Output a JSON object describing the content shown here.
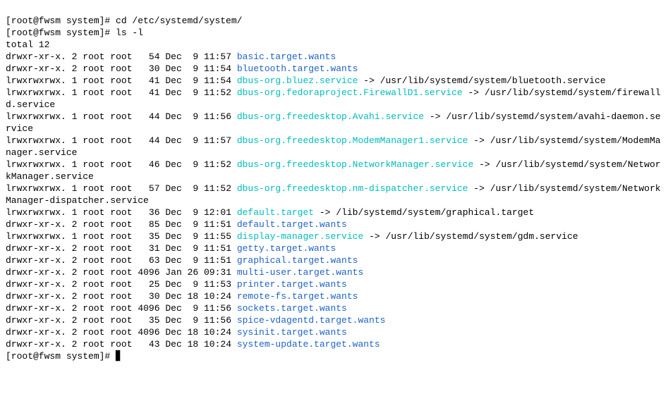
{
  "prompt_user": "root",
  "prompt_host": "fwsm",
  "prompt_cwd": "system",
  "prompt_char": "#",
  "commands": [
    "cd /etc/systemd/system/",
    "ls -l"
  ],
  "total_line": "total 12",
  "cursor_glyph": "▋",
  "entries": [
    {
      "perm": "drwxr-xr-x.",
      "links": "2",
      "owner": "root",
      "group": "root",
      "size": "54",
      "month": "Dec",
      "day": "9",
      "time": "11:57",
      "name": "basic.target.wants",
      "type": "dir"
    },
    {
      "perm": "drwxr-xr-x.",
      "links": "2",
      "owner": "root",
      "group": "root",
      "size": "30",
      "month": "Dec",
      "day": "9",
      "time": "11:54",
      "name": "bluetooth.target.wants",
      "type": "dir"
    },
    {
      "perm": "lrwxrwxrwx.",
      "links": "1",
      "owner": "root",
      "group": "root",
      "size": "41",
      "month": "Dec",
      "day": "9",
      "time": "11:54",
      "name": "dbus-org.bluez.service",
      "type": "link",
      "target": "/usr/lib/systemd/system/bluetooth.service"
    },
    {
      "perm": "lrwxrwxrwx.",
      "links": "1",
      "owner": "root",
      "group": "root",
      "size": "41",
      "month": "Dec",
      "day": "9",
      "time": "11:52",
      "name": "dbus-org.fedoraproject.FirewallD1.service",
      "type": "link",
      "target": "/usr/lib/systemd/system/firewalld.service"
    },
    {
      "perm": "lrwxrwxrwx.",
      "links": "1",
      "owner": "root",
      "group": "root",
      "size": "44",
      "month": "Dec",
      "day": "9",
      "time": "11:56",
      "name": "dbus-org.freedesktop.Avahi.service",
      "type": "link",
      "target": "/usr/lib/systemd/system/avahi-daemon.service"
    },
    {
      "perm": "lrwxrwxrwx.",
      "links": "1",
      "owner": "root",
      "group": "root",
      "size": "44",
      "month": "Dec",
      "day": "9",
      "time": "11:57",
      "name": "dbus-org.freedesktop.ModemManager1.service",
      "type": "link",
      "target": "/usr/lib/systemd/system/ModemManager.service"
    },
    {
      "perm": "lrwxrwxrwx.",
      "links": "1",
      "owner": "root",
      "group": "root",
      "size": "46",
      "month": "Dec",
      "day": "9",
      "time": "11:52",
      "name": "dbus-org.freedesktop.NetworkManager.service",
      "type": "link",
      "target": "/usr/lib/systemd/system/NetworkManager.service"
    },
    {
      "perm": "lrwxrwxrwx.",
      "links": "1",
      "owner": "root",
      "group": "root",
      "size": "57",
      "month": "Dec",
      "day": "9",
      "time": "11:52",
      "name": "dbus-org.freedesktop.nm-dispatcher.service",
      "type": "link",
      "target": "/usr/lib/systemd/system/NetworkManager-dispatcher.service"
    },
    {
      "perm": "lrwxrwxrwx.",
      "links": "1",
      "owner": "root",
      "group": "root",
      "size": "36",
      "month": "Dec",
      "day": "9",
      "time": "12:01",
      "name": "default.target",
      "type": "link",
      "target": "/lib/systemd/system/graphical.target"
    },
    {
      "perm": "drwxr-xr-x.",
      "links": "2",
      "owner": "root",
      "group": "root",
      "size": "85",
      "month": "Dec",
      "day": "9",
      "time": "11:51",
      "name": "default.target.wants",
      "type": "dir"
    },
    {
      "perm": "lrwxrwxrwx.",
      "links": "1",
      "owner": "root",
      "group": "root",
      "size": "35",
      "month": "Dec",
      "day": "9",
      "time": "11:55",
      "name": "display-manager.service",
      "type": "link",
      "target": "/usr/lib/systemd/system/gdm.service"
    },
    {
      "perm": "drwxr-xr-x.",
      "links": "2",
      "owner": "root",
      "group": "root",
      "size": "31",
      "month": "Dec",
      "day": "9",
      "time": "11:51",
      "name": "getty.target.wants",
      "type": "dir"
    },
    {
      "perm": "drwxr-xr-x.",
      "links": "2",
      "owner": "root",
      "group": "root",
      "size": "63",
      "month": "Dec",
      "day": "9",
      "time": "11:51",
      "name": "graphical.target.wants",
      "type": "dir"
    },
    {
      "perm": "drwxr-xr-x.",
      "links": "2",
      "owner": "root",
      "group": "root",
      "size": "4096",
      "month": "Jan",
      "day": "26",
      "time": "09:31",
      "name": "multi-user.target.wants",
      "type": "dir"
    },
    {
      "perm": "drwxr-xr-x.",
      "links": "2",
      "owner": "root",
      "group": "root",
      "size": "25",
      "month": "Dec",
      "day": "9",
      "time": "11:53",
      "name": "printer.target.wants",
      "type": "dir"
    },
    {
      "perm": "drwxr-xr-x.",
      "links": "2",
      "owner": "root",
      "group": "root",
      "size": "30",
      "month": "Dec",
      "day": "18",
      "time": "10:24",
      "name": "remote-fs.target.wants",
      "type": "dir"
    },
    {
      "perm": "drwxr-xr-x.",
      "links": "2",
      "owner": "root",
      "group": "root",
      "size": "4096",
      "month": "Dec",
      "day": "9",
      "time": "11:56",
      "name": "sockets.target.wants",
      "type": "dir"
    },
    {
      "perm": "drwxr-xr-x.",
      "links": "2",
      "owner": "root",
      "group": "root",
      "size": "35",
      "month": "Dec",
      "day": "9",
      "time": "11:56",
      "name": "spice-vdagentd.target.wants",
      "type": "dir"
    },
    {
      "perm": "drwxr-xr-x.",
      "links": "2",
      "owner": "root",
      "group": "root",
      "size": "4096",
      "month": "Dec",
      "day": "18",
      "time": "10:24",
      "name": "sysinit.target.wants",
      "type": "dir"
    },
    {
      "perm": "drwxr-xr-x.",
      "links": "2",
      "owner": "root",
      "group": "root",
      "size": "43",
      "month": "Dec",
      "day": "18",
      "time": "10:24",
      "name": "system-update.target.wants",
      "type": "dir"
    }
  ]
}
